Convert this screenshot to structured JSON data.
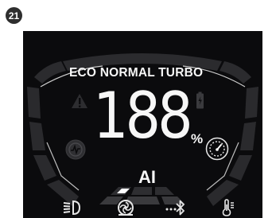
{
  "figure_number": "21",
  "display": {
    "modes": "ECO NORMAL TURBO",
    "speed": "188",
    "unit": "%",
    "assist_label": "AI"
  },
  "icons": {
    "warning": "warning-triangle-icon",
    "battery": "battery-charging-icon",
    "eco_mode": "eco-pulse-icon",
    "turbo_mode": "speedometer-icon",
    "headlight": "headlight-icon",
    "fan": "turbo-fan-icon",
    "bluetooth": "bluetooth-icon",
    "temperature": "thermometer-icon"
  },
  "colors": {
    "panel_bg": "#0b0b0d",
    "segment": "#2a2a2d",
    "active": "#f7f7f7"
  }
}
